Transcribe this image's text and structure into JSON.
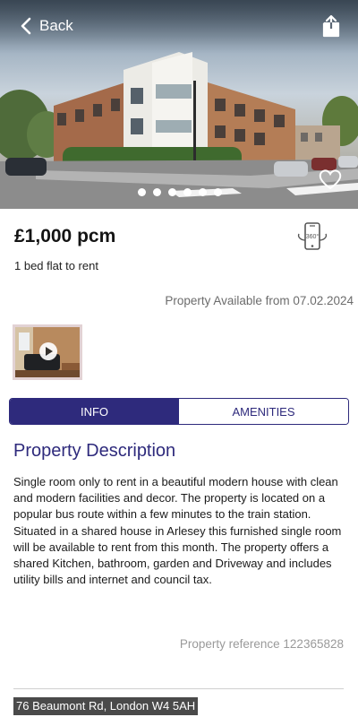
{
  "header": {
    "back_label": "Back",
    "back_icon": "chevron-left-icon",
    "share_icon": "share-icon"
  },
  "gallery": {
    "image_alt": "Modern apartment building on street corner",
    "slide_count": 6,
    "favorite_icon": "heart-icon"
  },
  "listing": {
    "price": "£1,000 pcm",
    "type": "1 bed flat to rent",
    "available": "Property Available from 07.02.2024",
    "vr_icon": "360-phone-icon"
  },
  "media": {
    "video_thumb_icon": "play-icon"
  },
  "tabs": [
    {
      "label": "INFO",
      "active": true
    },
    {
      "label": "AMENITIES",
      "active": false
    }
  ],
  "description": {
    "title": "Property Description",
    "text": "Single room only to rent in a beautiful modern house with clean and modern facilities and decor. The property is located on a popular bus route within a few minutes to the train station. Situated in a shared house in Arlesey this furnished single room will be available to rent from this month. The property offers a shared Kitchen, bathroom, garden and Driveway and includes utility bills and internet and council tax."
  },
  "reference": "Property reference 122365828",
  "address": "76 Beaumont Rd, London W4 5AH",
  "colors": {
    "accent": "#2e2a7c",
    "muted_text": "#6c6c6c"
  }
}
